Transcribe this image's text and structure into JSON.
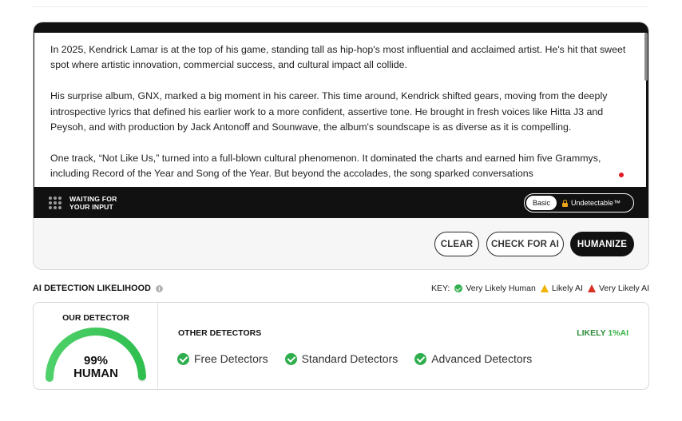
{
  "editor": {
    "paragraphs": [
      "In 2025, Kendrick Lamar is at the top of his game, standing tall as hip-hop's most influential and acclaimed artist. He's hit that sweet spot where artistic innovation, commercial success, and cultural impact all collide.",
      "His surprise album, GNX, marked a big moment in his career. This time around, Kendrick shifted gears, moving from the deeply introspective lyrics that defined his earlier work to a more confident, assertive tone. He brought in fresh voices like Hitta J3 and Peysoh, and with production by Jack Antonoff and Sounwave, the album's soundscape is as diverse as it is compelling.",
      "One track, “Not Like Us,” turned into a full-blown cultural phenomenon. It dominated the charts and earned him five Grammys, including Record of the Year and Song of the Year. But beyond the accolades, the song sparked conversations"
    ],
    "status_line1": "WAITING FOR",
    "status_line2": "YOUR INPUT",
    "mode_basic": "Basic",
    "mode_undetectable": "Undetectable™"
  },
  "actions": {
    "clear": "CLEAR",
    "check": "CHECK FOR AI",
    "humanize": "HUMANIZE"
  },
  "detection": {
    "heading": "AI DETECTION LIKELIHOOD",
    "key_label": "KEY:",
    "key_human": "Very Likely Human",
    "key_likely_ai": "Likely AI",
    "key_very_ai": "Very Likely AI",
    "our_detector_title": "OUR DETECTOR",
    "gauge_percent": "99%",
    "gauge_label": "HUMAN",
    "gauge_fraction": 0.99,
    "other_title": "OTHER DETECTORS",
    "likely_prefix": "LIKELY",
    "likely_value": "1%AI",
    "detectors": [
      "Free Detectors",
      "Standard Detectors",
      "Advanced Detectors"
    ]
  },
  "colors": {
    "accent_green": "#2fae4e",
    "warning_yellow": "#f0b400",
    "danger_red": "#d93025",
    "dark": "#111111"
  }
}
